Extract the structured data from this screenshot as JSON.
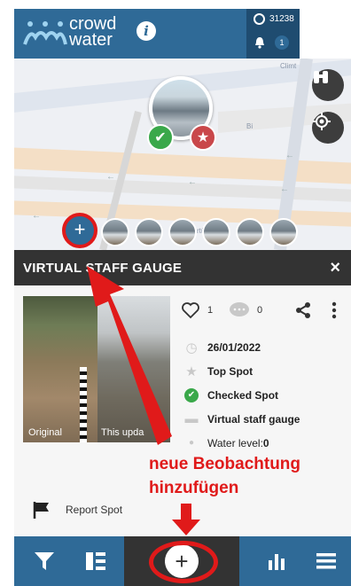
{
  "header": {
    "brand_line1": "crowd",
    "brand_line2": "water",
    "info_label": "i",
    "score": "31238",
    "notification_count": "1"
  },
  "map": {
    "labels": [
      "Climt",
      "rtürCkm",
      "Bi"
    ]
  },
  "panel": {
    "title": "VIRTUAL STAFF GAUGE",
    "close_label": "×",
    "likes": "1",
    "comments": "0",
    "photo_label_left": "Original",
    "photo_label_right": "This upda",
    "meta": {
      "date": "26/01/2022",
      "top_spot": "Top Spot",
      "checked": "Checked Spot",
      "category": "Virtual staff gauge",
      "water_level_label": "Water level: ",
      "water_level_value": "0"
    },
    "report_label": "Report Spot"
  },
  "annotation": {
    "line1": "neue Beobachtung",
    "line2": "hinzufügen"
  },
  "colors": {
    "brand_blue": "#2f6a97",
    "dark": "#333333",
    "annotation_red": "#e01a1a",
    "check_green": "#3aa84a",
    "star_red": "#c9474a"
  },
  "icons": [
    "info-icon",
    "trophy-icon",
    "bell-icon",
    "binoculars-icon",
    "locate-icon",
    "check-icon",
    "star-icon",
    "heart-icon",
    "comment-icon",
    "share-icon",
    "more-icon",
    "clock-icon",
    "folder-icon",
    "flag-icon",
    "filter-icon",
    "list-icon",
    "plus-icon",
    "chart-icon",
    "menu-icon"
  ]
}
